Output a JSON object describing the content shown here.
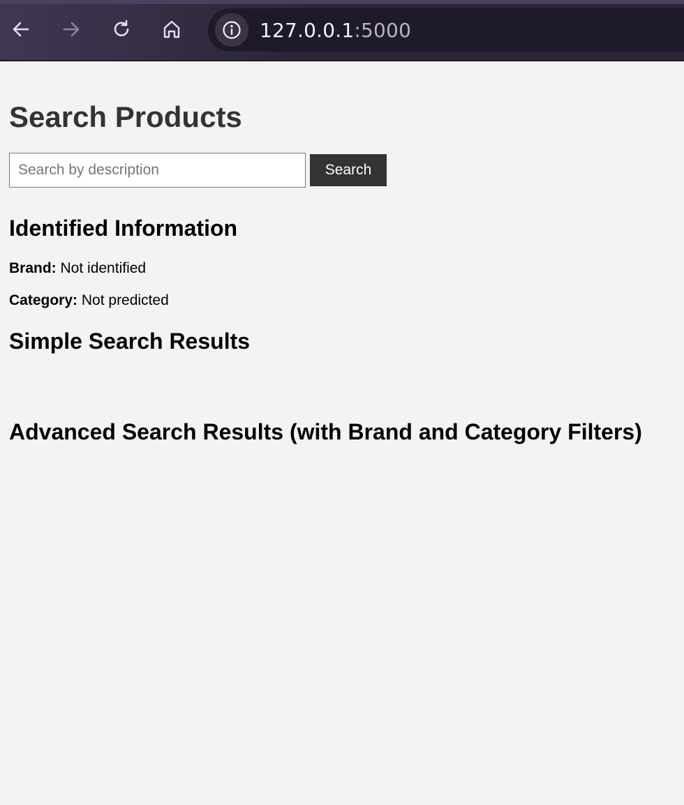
{
  "browser": {
    "url_host": "127.0.0.1",
    "url_port": ":5000",
    "icons": [
      "back-arrow-icon",
      "forward-arrow-icon",
      "reload-icon",
      "home-icon",
      "info-icon"
    ]
  },
  "page": {
    "title": "Search Products",
    "search": {
      "placeholder": "Search by description",
      "value": "",
      "button_label": "Search"
    },
    "identified": {
      "heading": "Identified Information",
      "brand_label": "Brand:",
      "brand_value": "Not identified",
      "category_label": "Category:",
      "category_value": "Not predicted"
    },
    "simple_results_heading": "Simple Search Results",
    "advanced_results_heading": "Advanced Search Results (with Brand and Category Filters)"
  },
  "colors": {
    "toolbar_bg": "#2b2536",
    "page_bg": "#f3f3f3",
    "button_bg": "#333333",
    "title": "#333333"
  }
}
